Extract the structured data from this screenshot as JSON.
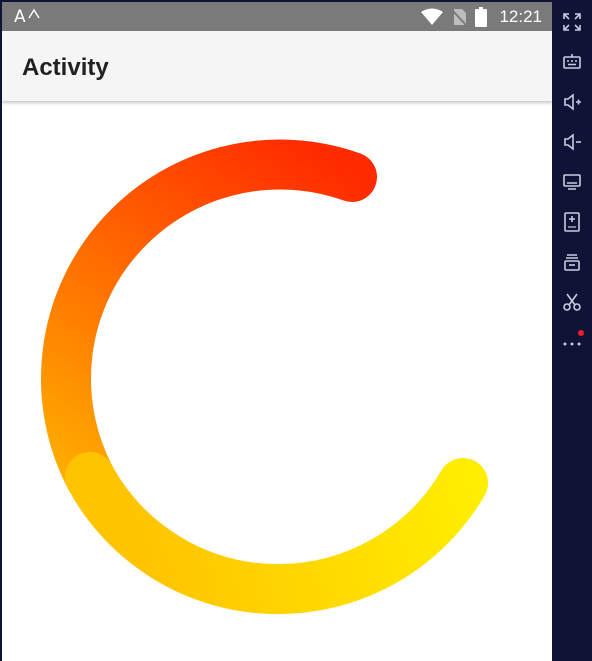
{
  "status_bar": {
    "carrier_glyph": "A",
    "time": "12:21",
    "icons": [
      "wifi-icon",
      "no-sim-icon",
      "battery-icon"
    ]
  },
  "app_bar": {
    "title": "Activity"
  },
  "progress_ring": {
    "start_color": "#ffee00",
    "end_color": "#ff2200",
    "track_color": "#ffffff"
  },
  "emulator_toolbar": {
    "tools": [
      "fullscreen-icon",
      "keyboard-icon",
      "volume-up-icon",
      "volume-down-icon",
      "screen-icon",
      "install-apk-icon",
      "layers-icon",
      "cut-icon",
      "more-icon"
    ],
    "notification_color": "#e8202a"
  }
}
